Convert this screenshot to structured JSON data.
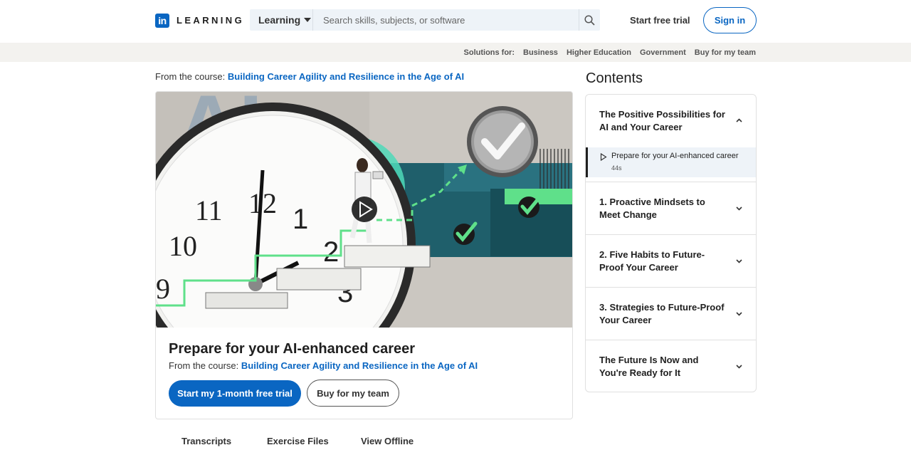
{
  "header": {
    "logo_letters": "in",
    "logo_text": "LEARNING",
    "learning_dropdown": "Learning",
    "search_placeholder": "Search skills, subjects, or software",
    "start_trial": "Start free trial",
    "sign_in": "Sign in"
  },
  "subnav": {
    "label": "Solutions for:",
    "items": [
      "Business",
      "Higher Education",
      "Government",
      "Buy for my team"
    ]
  },
  "course": {
    "from_label": "From the course:",
    "course_title": "Building Career Agility and Resilience in the Age of AI"
  },
  "video": {
    "title": "Prepare for your AI-enhanced career",
    "from_label": "From the course:",
    "course_title": "Building Career Agility and Resilience in the Age of AI",
    "primary_button": "Start my 1-month free trial",
    "secondary_button": "Buy for my team",
    "thumbnail_text": "AI"
  },
  "tabs": [
    "Transcripts",
    "Exercise Files",
    "View Offline"
  ],
  "contents": {
    "title": "Contents",
    "chapters": [
      {
        "label": "The Positive Possibilities for AI and Your Career",
        "expanded": true
      },
      {
        "label": "1. Proactive Mindsets to Meet Change",
        "expanded": false
      },
      {
        "label": "2. Five Habits to Future-Proof Your Career",
        "expanded": false
      },
      {
        "label": "3. Strategies to Future-Proof Your Career",
        "expanded": false
      },
      {
        "label": "The Future Is Now and You're Ready for It",
        "expanded": false
      }
    ],
    "active_lesson": {
      "title": "Prepare for your AI-enhanced career",
      "duration": "44s"
    }
  },
  "colors": {
    "brand_blue": "#0a66c2",
    "search_bg": "#eef3f8",
    "subnav_bg": "#f3f2ef",
    "accent_green": "#5fe08a",
    "teal": "#1f5f6b"
  }
}
